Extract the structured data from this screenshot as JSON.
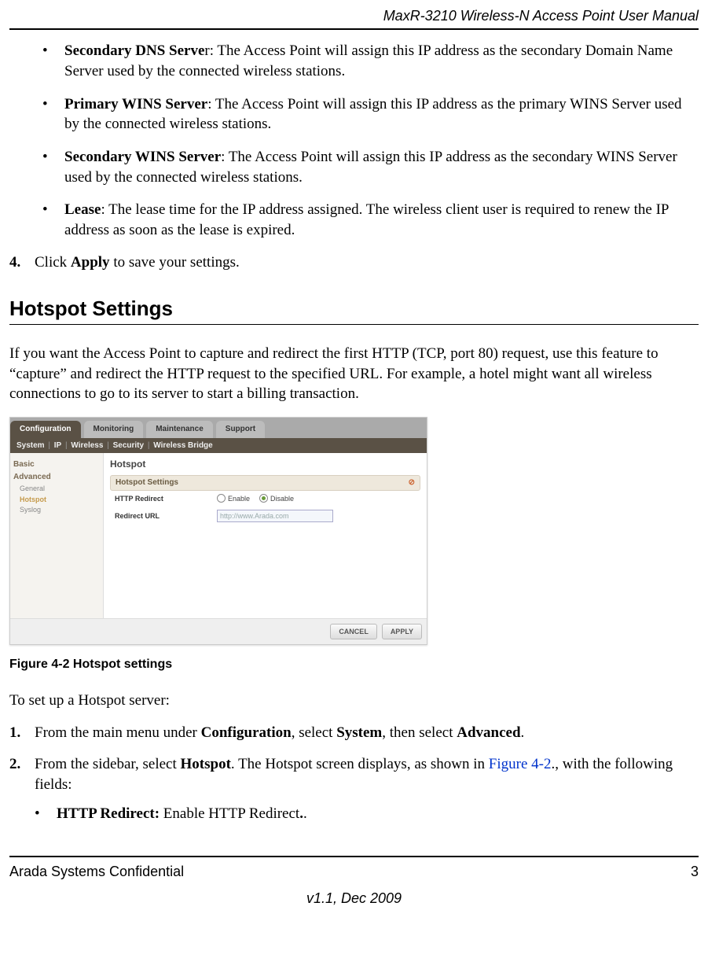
{
  "header": {
    "right": "MaxR-3210 Wireless-N Access Point User Manual"
  },
  "bullets": [
    {
      "term": "Secondary DNS Serve",
      "term_tail": "r",
      "desc": ": The Access Point will assign this IP address as the secondary Domain Name Server used by the connected wireless stations."
    },
    {
      "term": "Primary WINS Server",
      "term_tail": "",
      "desc": ": The Access Point will assign this IP address as the primary WINS Server used by the connected wireless stations."
    },
    {
      "term": "Secondary WINS Server",
      "term_tail": "",
      "desc": ": The Access Point will assign this IP address as the secondary WINS Server used by the connected wireless stations."
    },
    {
      "term": "Lease",
      "term_tail": "",
      "desc": ": The lease time for the IP address assigned. The wireless client user is required to renew the IP address as soon as the lease is expired."
    }
  ],
  "step4": {
    "num": "4.",
    "pre": "Click ",
    "bold": "Apply",
    "post": " to save your settings."
  },
  "section": {
    "title": "Hotspot Settings"
  },
  "intro": "If you want the Access Point to capture and redirect the first HTTP (TCP, port 80) request, use this feature to “capture” and redirect the HTTP request to the specified URL. For example, a hotel might want all wireless connections to go to its server to start a billing transaction.",
  "figure": {
    "tabs": [
      "Configuration",
      "Monitoring",
      "Maintenance",
      "Support"
    ],
    "subnav": [
      "System",
      "IP",
      "Wireless",
      "Security",
      "Wireless Bridge"
    ],
    "sidebar": {
      "basic": "Basic",
      "advanced": "Advanced",
      "items": [
        "General",
        "Hotspot",
        "Syslog"
      ]
    },
    "panel": {
      "title": "Hotspot",
      "header": "Hotspot Settings",
      "row1": {
        "label": "HTTP Redirect",
        "opt_enable": "Enable",
        "opt_disable": "Disable"
      },
      "row2": {
        "label": "Redirect URL",
        "placeholder": "http://www.Arada.com"
      }
    },
    "buttons": {
      "cancel": "CANCEL",
      "apply": "APPLY"
    }
  },
  "caption": "Figure 4-2  Hotspot settings",
  "after": {
    "lead": "To set up a Hotspot server:",
    "step1": {
      "num": "1.",
      "pre": "From the main menu under ",
      "b1": "Configuration",
      "mid1": ", select ",
      "b2": "System",
      "mid2": ", then select ",
      "b3": "Advanced",
      "post": "."
    },
    "step2": {
      "num": "2.",
      "pre": "From the sidebar, select ",
      "b1": "Hotspot",
      "mid": ". The Hotspot screen displays, as shown in ",
      "link": "Figure 4-2",
      "post": "., with the following fields:"
    },
    "sub_bullet": {
      "b": "HTTP Redirect: ",
      "text": "Enable HTTP Redirect",
      "b2": ".",
      "tail": "."
    }
  },
  "footer": {
    "left": "Arada Systems Confidential",
    "right": "3",
    "center": "v1.1, Dec 2009"
  }
}
